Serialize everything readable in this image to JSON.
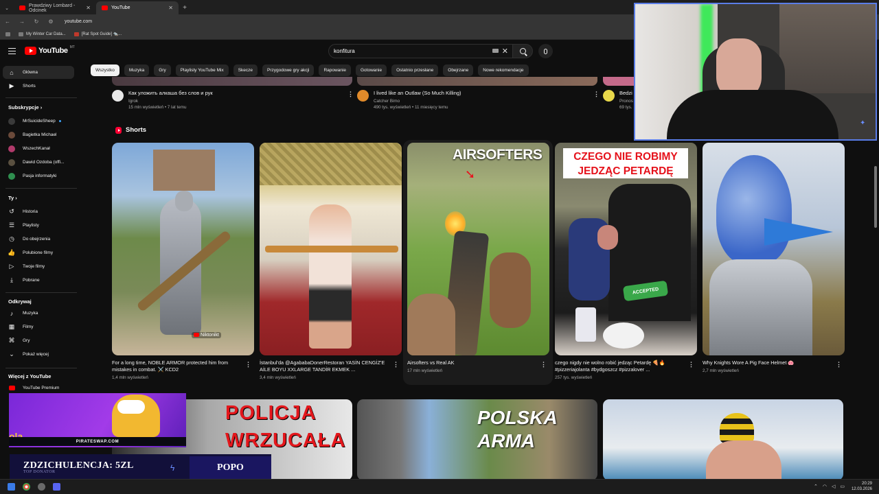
{
  "browser": {
    "tabs": [
      {
        "title": "Prawdziwy Lombard - Odcinek",
        "active": false
      },
      {
        "title": "YouTube",
        "active": true
      }
    ],
    "url": "youtube.com",
    "bookmarks": [
      "My Winter Car Data...",
      "[Rat Spot Guide] 🐀..."
    ]
  },
  "youtube": {
    "logo_text": "YouTube",
    "country_code": "MT",
    "search_value": "konfitura",
    "chips": [
      "Wszystko",
      "Muzyka",
      "Gry",
      "Playlisty YouTube Mix",
      "Skecze",
      "Przygodowe gry akcji",
      "Rapowanie",
      "Gotowanie",
      "Ostatnio przesłane",
      "Obejrzane",
      "Nowe rekomendacje"
    ],
    "active_chip": "Wszystko"
  },
  "sidebar": {
    "top": [
      {
        "label": "Główna",
        "icon": "home-icon",
        "active": true
      },
      {
        "label": "Shorts",
        "icon": "shorts-icon",
        "active": false
      }
    ],
    "subscriptions_header": "Subskrypcje",
    "subscriptions": [
      {
        "label": "MrSuicideSheep",
        "color": "#3a3a3a",
        "live": true
      },
      {
        "label": "Bagietka Michael",
        "color": "#6b4a3a",
        "live": false
      },
      {
        "label": "WszechKanał",
        "color": "#b03a6a",
        "live": false
      },
      {
        "label": "Dawid Ozdoba (offi...",
        "color": "#5a5040",
        "live": false
      },
      {
        "label": "Pasja informatyki",
        "color": "#2f8f4f",
        "live": false
      }
    ],
    "you_header": "Ty",
    "you": [
      {
        "label": "Historia",
        "icon": "history-icon"
      },
      {
        "label": "Playlisty",
        "icon": "playlist-icon"
      },
      {
        "label": "Do obejrzenia",
        "icon": "clock-icon"
      },
      {
        "label": "Polubione filmy",
        "icon": "thumb-up-icon"
      },
      {
        "label": "Twoje filmy",
        "icon": "your-videos-icon"
      },
      {
        "label": "Pobrane",
        "icon": "download-icon"
      }
    ],
    "explore_header": "Odkrywaj",
    "explore": [
      {
        "label": "Muzyka",
        "icon": "music-icon"
      },
      {
        "label": "Filmy",
        "icon": "film-icon"
      },
      {
        "label": "Gry",
        "icon": "gamepad-icon"
      },
      {
        "label": "Pokaż więcej",
        "icon": "chevron-down-icon"
      }
    ],
    "more_header": "Więcej z YouTube",
    "more": [
      {
        "label": "YouTube Premium",
        "icon": "youtube-premium-icon"
      }
    ]
  },
  "top_videos": [
    {
      "title": "Как уложить алкаша без слов и рук",
      "channel": "Igrok",
      "meta": "15 mln wyświetleń • 7 lat temu",
      "avatar_color": "#e8e8e8"
    },
    {
      "title": "I lived like an Outlaw (So Much Killing)",
      "channel": "Catcher Bimo",
      "meta": "490 tys. wyświetleń • 11 miesięcy temu",
      "avatar_color": "#e08a2a"
    },
    {
      "title": "Bedzi",
      "channel": "Pronos",
      "meta": "69 tys.",
      "avatar_color": "#e8d84a"
    }
  ],
  "shorts": {
    "heading": "Shorts",
    "items": [
      {
        "title": "For a long time, NOBLE ARMOR protected him from mistakes in combat. ⚔️ KCD2",
        "views": "1,4 mln wyświetleń",
        "watermark": "Niktonikt"
      },
      {
        "title": "İstanbul'da @AgababaDonerRestoran YASİN CENGİZ'E AİLE BOYU XXLARGE TANDİR EKMEK ...",
        "views": "3,4 mln wyświetleń"
      },
      {
        "title": "Airsofters vs Real AK",
        "views": "17 mln wyświetleń",
        "overlay": "AIRSOFTERS"
      },
      {
        "title": "czego nigdy nie wolno robić jedząc Petardę 🍕🔥 #pizzeriajolanta #bydgoszcz #pizzalover ...",
        "views": "257 tys. wyświetleń",
        "overlay": "CZEGO NIE ROBIMY JEDZĄC PETARDĘ"
      },
      {
        "title": "Why Knights Wore A Pig Face Helmet 🐽",
        "views": "2,7 mln wyświetleń"
      }
    ]
  },
  "bottom_thumbs": [
    {
      "overlay": "POLICJA WRZUCAŁA"
    },
    {
      "overlay": "POLSKA ARMA"
    },
    {
      "overlay": ""
    }
  ],
  "stream_overlay": {
    "alert_site": "PIRATESWAP.COM",
    "donor_line": "ZDZICHULENCJA: 5ZL",
    "donor_sub": "TOP DONATOR",
    "donor_right": "POPO"
  },
  "taskbar": {
    "time": "20:29",
    "date": "12.03.2026"
  }
}
